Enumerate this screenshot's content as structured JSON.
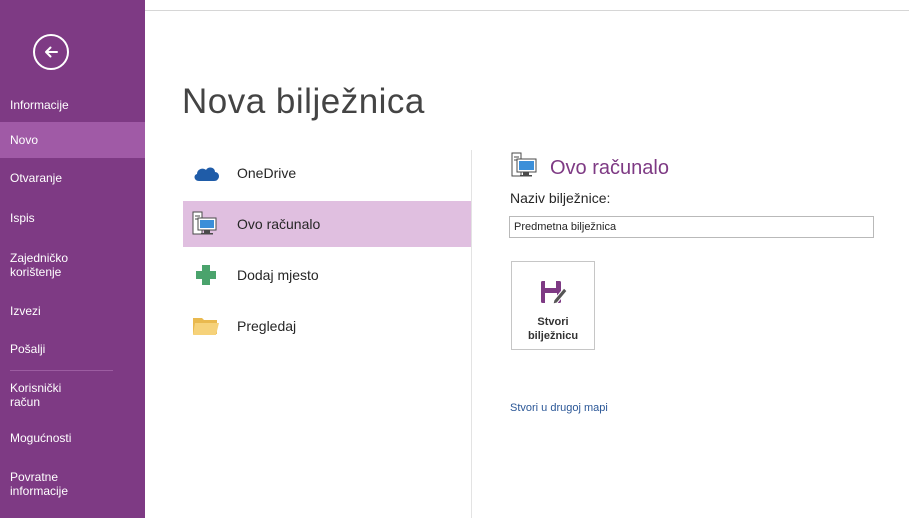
{
  "sidebar": {
    "back_icon": "back-arrow-icon",
    "items": [
      {
        "label": "Informacije"
      },
      {
        "label": "Novo"
      },
      {
        "label": "Otvaranje"
      },
      {
        "label": "Ispis"
      },
      {
        "label": "Zajedničko korištenje"
      },
      {
        "label": "Izvezi"
      },
      {
        "label": "Pošalji"
      },
      {
        "label": "Korisnički račun"
      },
      {
        "label": "Mogućnosti"
      },
      {
        "label": "Povratne informacije"
      }
    ],
    "active": "Novo"
  },
  "page": {
    "title": "Nova bilježnica"
  },
  "locations": [
    {
      "label": "OneDrive",
      "icon": "cloud-icon"
    },
    {
      "label": "Ovo računalo",
      "icon": "computer-icon"
    },
    {
      "label": "Dodaj mjesto",
      "icon": "plus-icon"
    },
    {
      "label": "Pregledaj",
      "icon": "folder-icon"
    }
  ],
  "right_panel": {
    "title": "Ovo računalo",
    "name_label": "Naziv bilježnice:",
    "name_value": "Predmetna bilježnica",
    "create_label_line1": "Stvori",
    "create_label_line2": "bilježnicu",
    "other_folder_link": "Stvori u drugoj mapi"
  },
  "colors": {
    "sidebar": "#7e3a84",
    "sidebar_active": "#a05aa6",
    "location_active": "#e0bfe0",
    "accent": "#7e3a84",
    "link": "#2b5797"
  }
}
